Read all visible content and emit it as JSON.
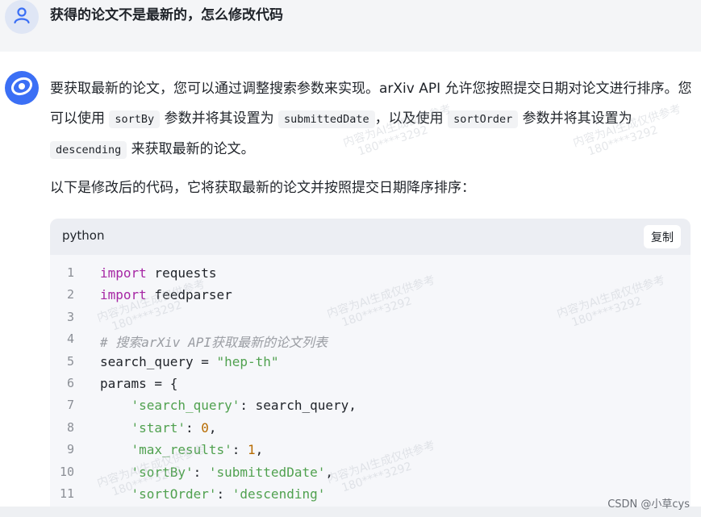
{
  "user": {
    "question": "获得的论文不是最新的，怎么修改代码",
    "avatar_icon": "user-icon"
  },
  "assistant": {
    "avatar_icon": "assistant-logo-icon",
    "para1_a": "要获取最新的论文，您可以通过调整搜索参数来实现。arXiv API 允许您按照提交日期对论文进行排序。您可以使用 ",
    "code1": "sortBy",
    "para1_b": " 参数并将其设置为 ",
    "code2": "submittedDate",
    "para1_c": "，以及使用 ",
    "code3": "sortOrder",
    "para1_d": " 参数并将其设置为 ",
    "code4": "descending",
    "para1_e": " 来获取最新的论文。",
    "para2": "以下是修改后的代码，它将获取最新的论文并按照提交日期降序排序："
  },
  "code_block": {
    "language": "python",
    "copy_label": "复制",
    "lines": [
      {
        "n": "1",
        "parts": [
          [
            "kw",
            "import"
          ],
          [
            "plain",
            " requests"
          ]
        ]
      },
      {
        "n": "2",
        "parts": [
          [
            "kw",
            "import"
          ],
          [
            "plain",
            " feedparser"
          ]
        ]
      },
      {
        "n": "3",
        "parts": []
      },
      {
        "n": "4",
        "parts": [
          [
            "cm",
            "# 搜索arXiv API获取最新的论文列表"
          ]
        ]
      },
      {
        "n": "5",
        "parts": [
          [
            "plain",
            "search_query = "
          ],
          [
            "str",
            "\"hep-th\""
          ]
        ]
      },
      {
        "n": "6",
        "parts": [
          [
            "plain",
            "params = {"
          ]
        ]
      },
      {
        "n": "7",
        "parts": [
          [
            "plain",
            "    "
          ],
          [
            "str",
            "'search_query'"
          ],
          [
            "plain",
            ": search_query,"
          ]
        ]
      },
      {
        "n": "8",
        "parts": [
          [
            "plain",
            "    "
          ],
          [
            "str",
            "'start'"
          ],
          [
            "plain",
            ": "
          ],
          [
            "num",
            "0"
          ],
          [
            "plain",
            ","
          ]
        ]
      },
      {
        "n": "9",
        "parts": [
          [
            "plain",
            "    "
          ],
          [
            "str",
            "'max_results'"
          ],
          [
            "plain",
            ": "
          ],
          [
            "num",
            "1"
          ],
          [
            "plain",
            ","
          ]
        ]
      },
      {
        "n": "10",
        "parts": [
          [
            "plain",
            "    "
          ],
          [
            "str",
            "'sortBy'"
          ],
          [
            "plain",
            ": "
          ],
          [
            "str",
            "'submittedDate'"
          ],
          [
            "plain",
            ","
          ]
        ]
      },
      {
        "n": "11",
        "parts": [
          [
            "plain",
            "    "
          ],
          [
            "str",
            "'sortOrder'"
          ],
          [
            "plain",
            ": "
          ],
          [
            "str",
            "'descending'"
          ]
        ]
      }
    ]
  },
  "watermark": {
    "line1": "内容为AI生成仅供参考",
    "line2": "180****3292"
  },
  "footer": {
    "credit": "CSDN @小草cys"
  }
}
